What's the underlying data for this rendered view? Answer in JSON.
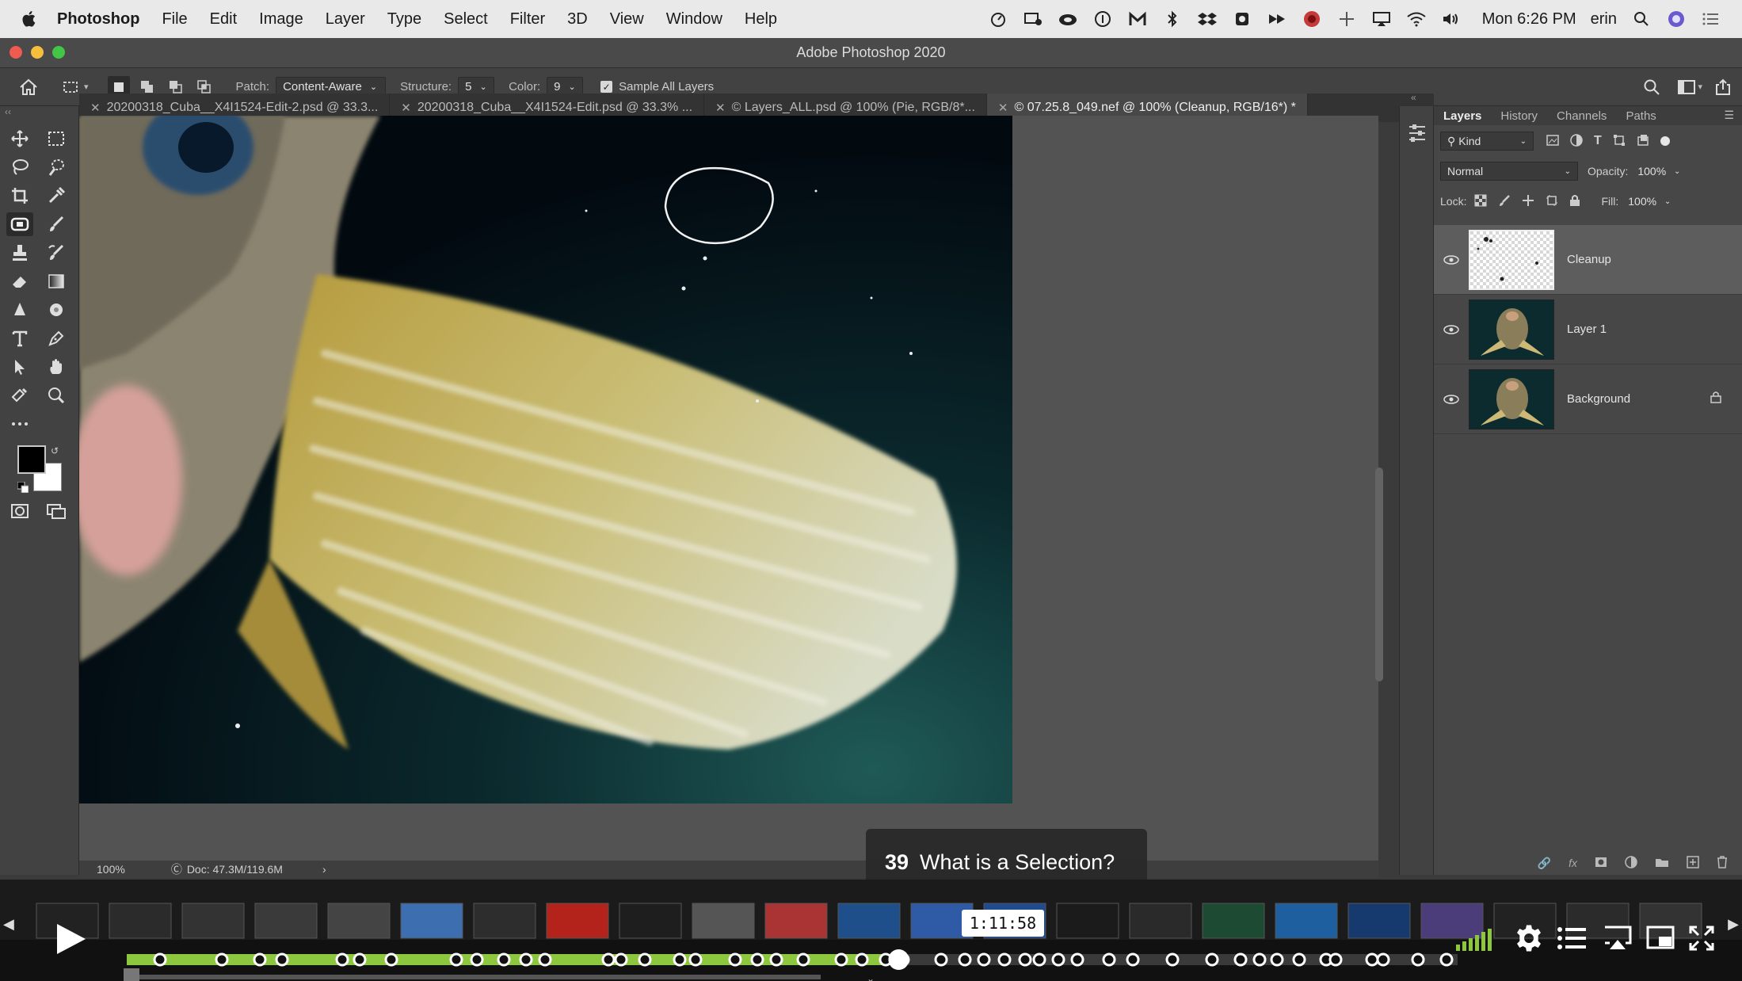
{
  "menubar": {
    "app_name": "Photoshop",
    "menus": [
      "File",
      "Edit",
      "Image",
      "Layer",
      "Type",
      "Select",
      "Filter",
      "3D",
      "View",
      "Window",
      "Help"
    ],
    "clock": "Mon 6:26 PM",
    "user": "erin"
  },
  "window": {
    "title": "Adobe Photoshop 2020"
  },
  "options": {
    "patch_label": "Patch:",
    "patch_value": "Content-Aware",
    "structure_label": "Structure:",
    "structure_value": "5",
    "color_label": "Color:",
    "color_value": "9",
    "sample_all_layers": "Sample All Layers"
  },
  "tabs": [
    {
      "label": "20200318_Cuba__X4I1524-Edit-2.psd @ 33.3..."
    },
    {
      "label": "20200318_Cuba__X4I1524-Edit.psd @ 33.3% ..."
    },
    {
      "label": "© Layers_ALL.psd @ 100% (Pie, RGB/8*..."
    },
    {
      "label": "© 07.25.8_049.nef @ 100% (Cleanup, RGB/16*) *"
    }
  ],
  "status": {
    "zoom": "100%",
    "doc": "Doc: 47.3M/119.6M"
  },
  "panel": {
    "tabs": [
      "Layers",
      "History",
      "Channels",
      "Paths"
    ],
    "kind_label": "Kind",
    "blend_mode": "Normal",
    "opacity_label": "Opacity:",
    "opacity_value": "100%",
    "lock_label": "Lock:",
    "fill_label": "Fill:",
    "fill_value": "100%",
    "layers": [
      {
        "name": "Cleanup"
      },
      {
        "name": "Layer 1"
      },
      {
        "name": "Background"
      }
    ]
  },
  "video": {
    "chapter_number": "39",
    "chapter_title": "What is a Selection?",
    "timestamp": "1:11:58",
    "progress": 0.58
  },
  "colors": {
    "accent": "#8dc63f",
    "canvas_bg": "#535353",
    "panel_bg": "#474747"
  }
}
